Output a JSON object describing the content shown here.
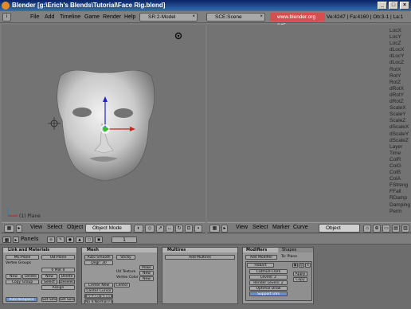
{
  "window": {
    "title": "Blender [g:\\Erich's Blends\\Tutorial\\Face Rig.blend]",
    "min": "_",
    "max": "□",
    "close": "×"
  },
  "menu": {
    "items": [
      "File",
      "Add",
      "Timeline",
      "Game",
      "Render",
      "Help"
    ],
    "screen": "SR:2-Model",
    "scene": "SCE:Scene",
    "url": "www.blender.org 245",
    "stats": "Ve:4247 | Fa:4160 | Ob:3-1 | La:1"
  },
  "view3d": {
    "label": "(1) Plane",
    "header": {
      "menus": [
        "View",
        "Select",
        "Object"
      ],
      "mode": "Object Mode"
    }
  },
  "ipo": {
    "channels": [
      "LocX",
      "LocY",
      "LocZ",
      "dLocX",
      "dLocY",
      "dLocZ",
      "RotX",
      "RotY",
      "RotZ",
      "dRotX",
      "dRotY",
      "dRotZ",
      "ScaleX",
      "ScaleY",
      "ScaleZ",
      "dScaleX",
      "dScaleY",
      "dScaleZ",
      "Layer",
      "Time",
      "ColR",
      "ColG",
      "ColB",
      "ColA",
      "FStreng",
      "FFall",
      "RDamp",
      "Damping",
      "Perm"
    ],
    "header": {
      "menus": [
        "View",
        "Select",
        "Marker",
        "Curve"
      ],
      "type": "Object"
    }
  },
  "buttons": {
    "header": {
      "panels_label": "Panels",
      "frame": "1"
    },
    "link": {
      "title": "Link and Materials",
      "me": "ME:Plane",
      "ob": "OB:Plane",
      "vgroups": "Vertex Groups",
      "mat": "0 Mat 0",
      "new": "New",
      "delete": "Delete",
      "copy": "Copy Group",
      "sel": "Select",
      "desel": "Deselect",
      "assign": "Assign",
      "autotex": "AutoTexSpace",
      "setsmooth": "Set Smooth",
      "setsolid": "Set Solid"
    },
    "mesh": {
      "title": "Mesh",
      "autosmooth": "Auto Smooth",
      "degr": "Degr: 30",
      "sticky": "Sticky",
      "make": "Make",
      "uvtex": "UV Texture",
      "new": "New",
      "vcol": "Vertex Color",
      "new2": "New",
      "centernew": "Center New",
      "center": "Center",
      "centercursor": "Center Cursor",
      "doublesided": "Double Sided",
      "novnormalflip": "No V.Normal Flip"
    },
    "multires": {
      "title": "Multires",
      "add": "Add Multires"
    },
    "modifiers": {
      "tab1": "Modifiers",
      "tab2": "Shapes",
      "add": "Add Modifier",
      "to": "To: Plane",
      "name": "Hobart",
      "catmull": "Catmull-Clark",
      "levels": "Levels: 2",
      "render": "Render Levels: 2",
      "optimal": "Optimal Draw",
      "support": "Support UVs",
      "apply": "Apply",
      "copy": "Copy"
    }
  }
}
